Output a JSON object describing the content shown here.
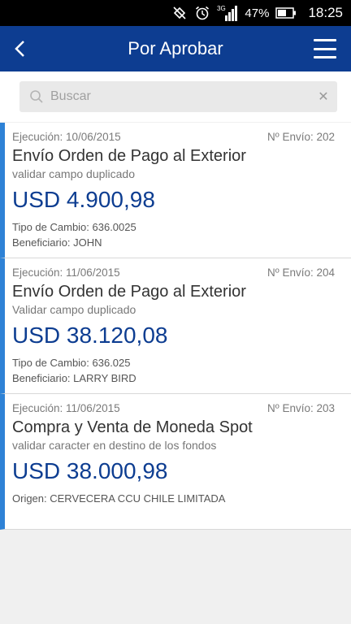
{
  "status_bar": {
    "battery_percent": "47%",
    "time": "18:25",
    "network": "3G",
    "icons": [
      "no-sync-icon",
      "alarm-icon",
      "signal-icon",
      "battery-icon"
    ]
  },
  "header": {
    "title": "Por Aprobar",
    "color": "#0d3d91"
  },
  "search": {
    "placeholder": "Buscar",
    "value": ""
  },
  "accent_color": "#2e82d6",
  "items": [
    {
      "execution": "Ejecución: 10/06/2015",
      "send_no": "Nº Envío: 202",
      "operation": "Envío Orden de Pago al Exterior",
      "description": "validar campo duplicado",
      "amount": "USD 4.900,98",
      "detail1": "Tipo de Cambio: 636.0025",
      "detail2": "Beneficiario: JOHN"
    },
    {
      "execution": "Ejecución: 11/06/2015",
      "send_no": "Nº Envío: 204",
      "operation": "Envío Orden de Pago al Exterior",
      "description": "Validar campo duplicado",
      "amount": "USD 38.120,08",
      "detail1": "Tipo de Cambio: 636.025",
      "detail2": "Beneficiario: LARRY BIRD"
    },
    {
      "execution": "Ejecución: 11/06/2015",
      "send_no": "Nº Envío: 203",
      "operation": "Compra y Venta de Moneda Spot",
      "description": "validar caracter en destino de los fondos",
      "amount": "USD 38.000,98",
      "detail1": "Origen: CERVECERA CCU CHILE LIMITADA"
    }
  ]
}
